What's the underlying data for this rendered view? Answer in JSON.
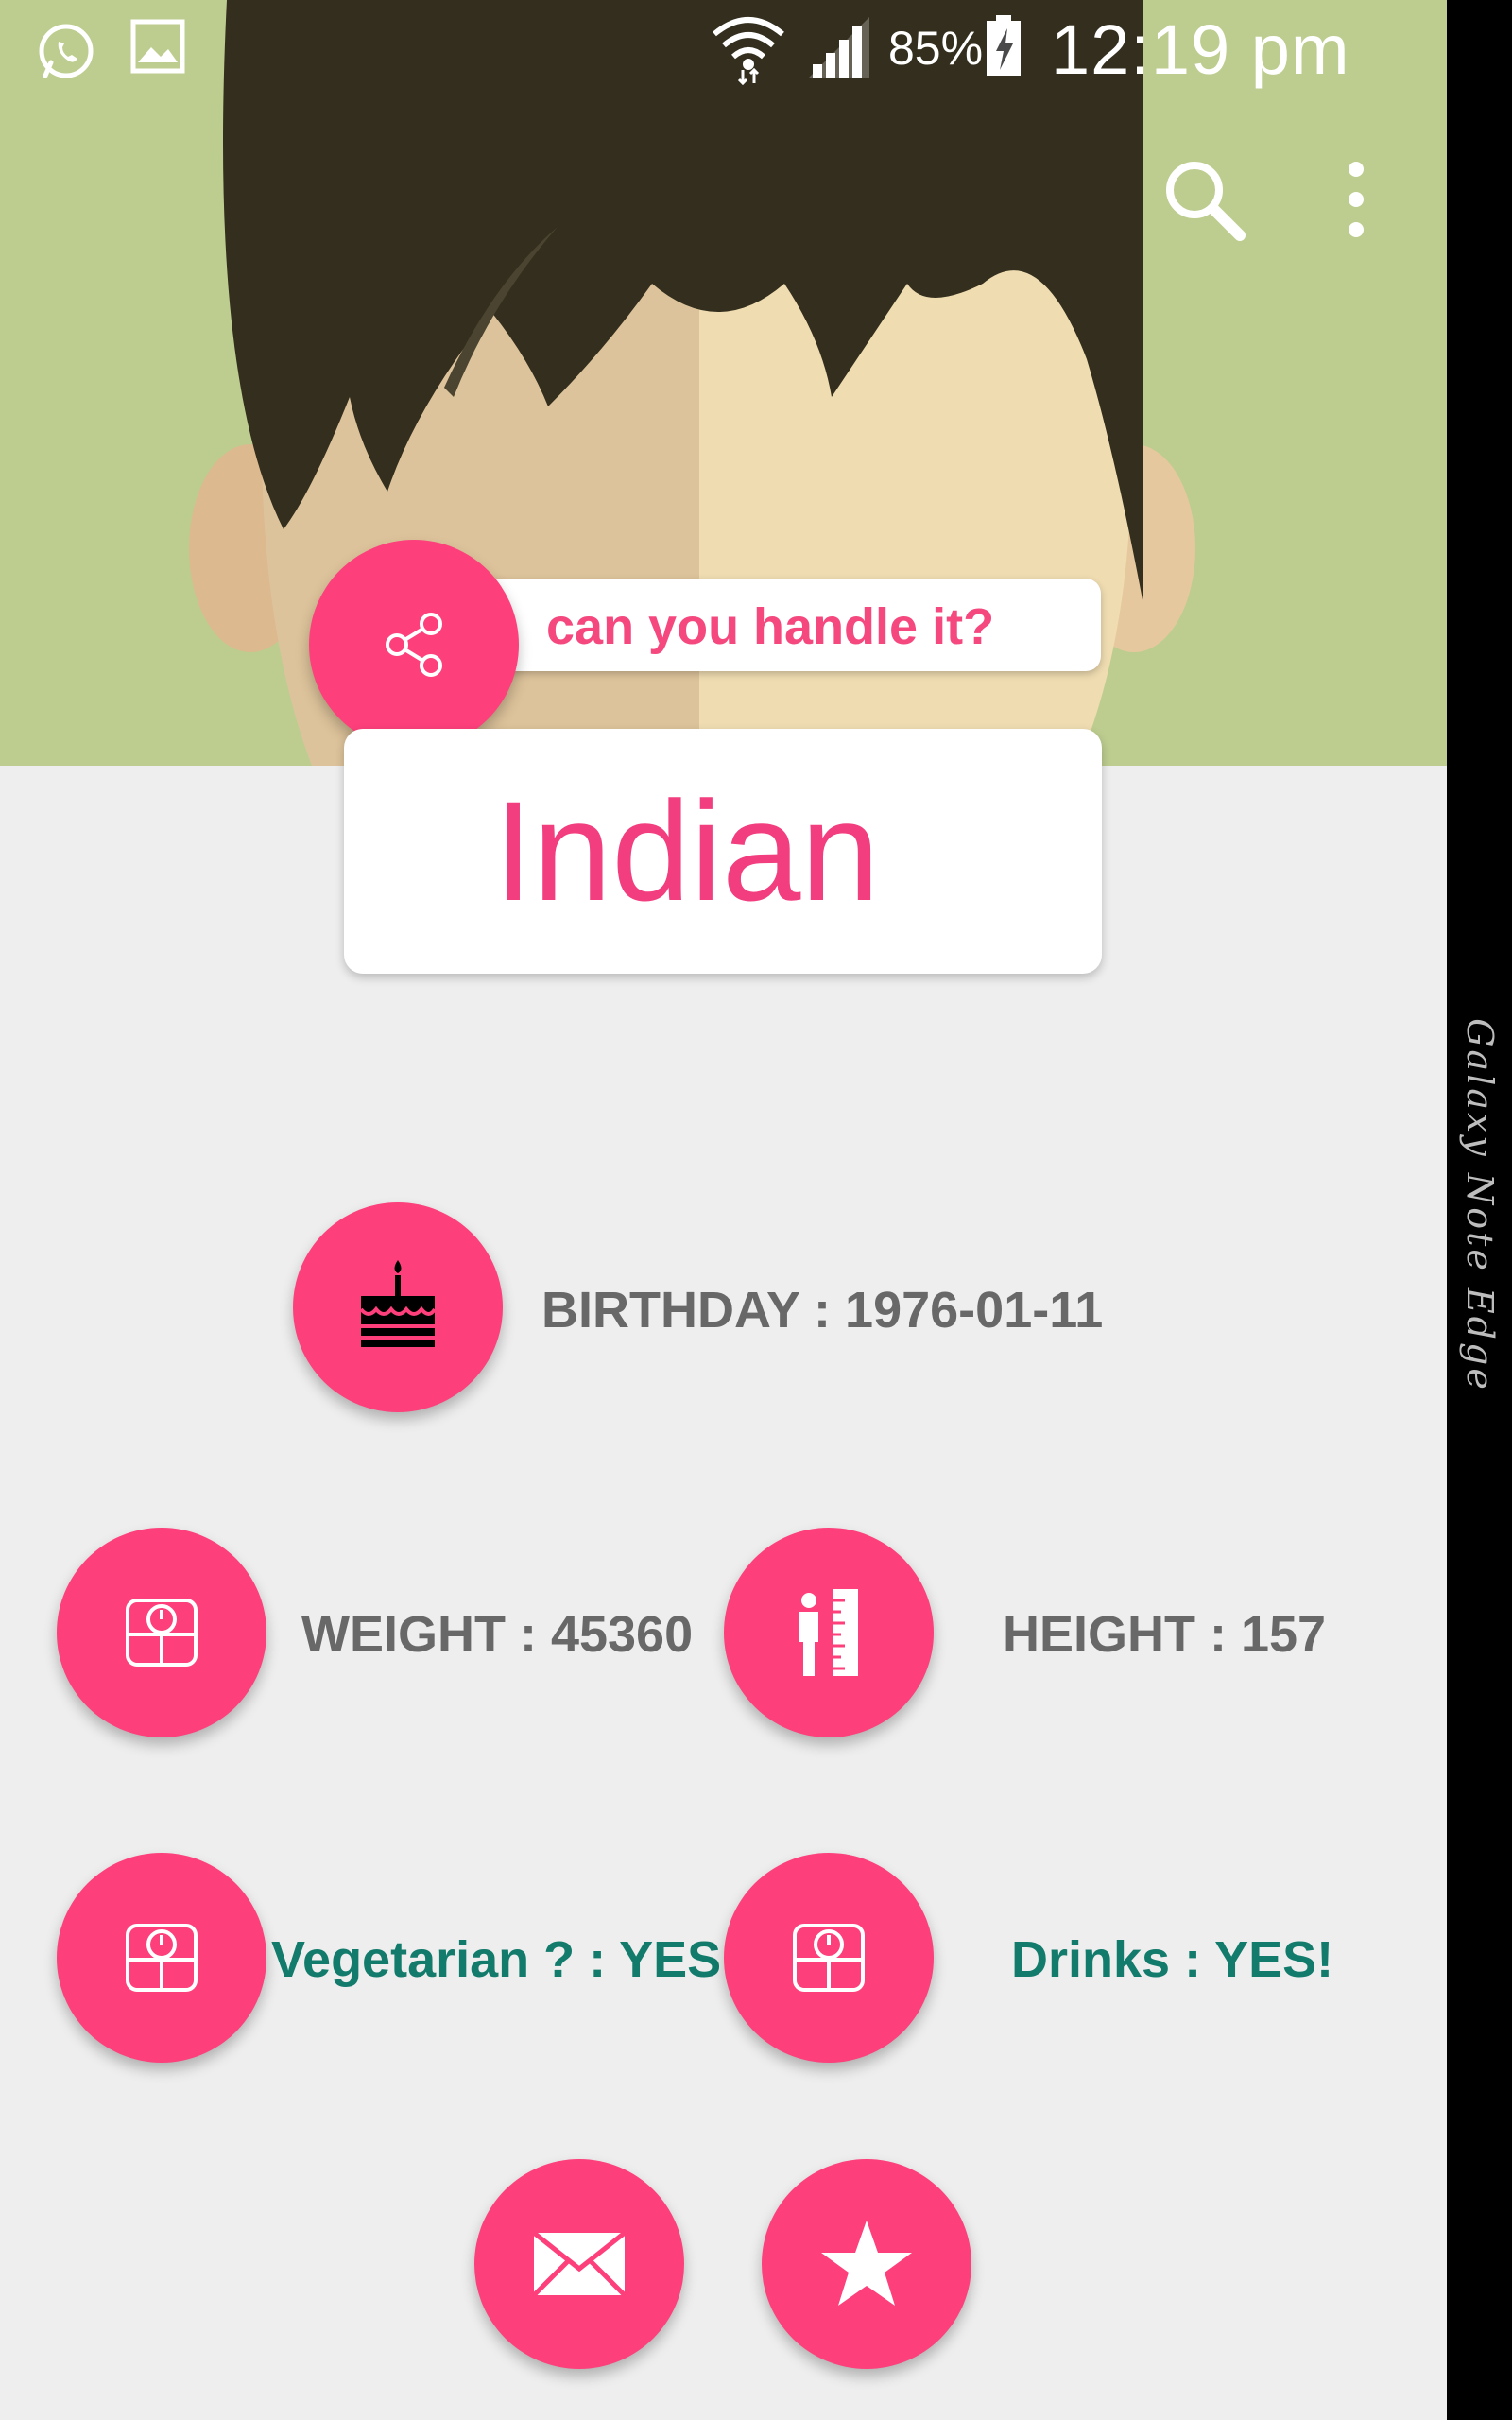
{
  "status_bar": {
    "icons": [
      "whatsapp-icon",
      "gallery-icon",
      "wifi-icon",
      "signal-icon",
      "battery-charging-icon"
    ],
    "battery": "85%",
    "time": "12:19 pm"
  },
  "toolbar": {
    "actions": [
      "search-icon",
      "more-vert-icon"
    ]
  },
  "profile": {
    "tagline": "can you handle it?",
    "name": "Indian"
  },
  "details": {
    "birthday": "BIRTHDAY : 1976-01-11",
    "weight": "WEIGHT : 45360",
    "height": "HEIGHT : 157",
    "vegetarian": "Vegetarian ? : YES!",
    "drinks": "Drinks : YES!"
  },
  "actions": [
    "share-icon",
    "email-icon",
    "star-icon"
  ],
  "device": {
    "edge_label": "Galaxy Note Edge"
  },
  "colors": {
    "accent": "#fd3f7b",
    "name_text": "#f23d7e",
    "header_bg": "#bdcd8f",
    "teal_text": "#127b6c",
    "grey_text": "#686868",
    "page_bg": "#eeeeee"
  }
}
